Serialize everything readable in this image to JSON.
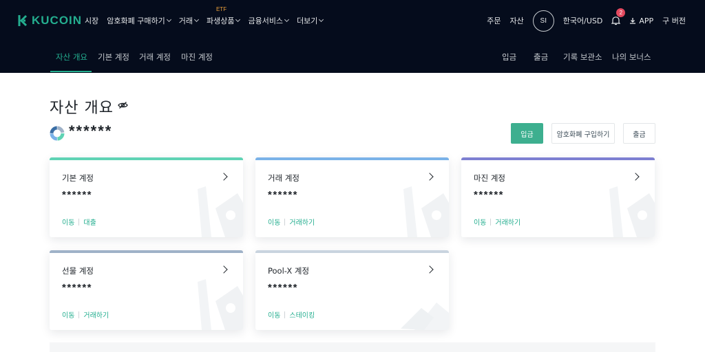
{
  "brand": {
    "name": "KUCOIN",
    "color": "#24ae8f"
  },
  "topnav": {
    "items": [
      {
        "label": "시장",
        "chevron": false
      },
      {
        "label": "암호화폐 구매하기",
        "chevron": true
      },
      {
        "label": "거래",
        "chevron": true
      },
      {
        "label": "파생상품",
        "chevron": true,
        "tag": "ETF"
      },
      {
        "label": "금융서비스",
        "chevron": true
      },
      {
        "label": "더보기",
        "chevron": true
      }
    ],
    "right": {
      "orders": "주문",
      "assets": "자산",
      "avatar": "SI",
      "language": "한국어/USD",
      "notifications": "2",
      "app": "APP",
      "old_version": "구 버전"
    }
  },
  "subnav": {
    "tabs": [
      "자산 개요",
      "기본 계정",
      "거래 계정",
      "마진 계정"
    ],
    "active": "자산 개요",
    "right": [
      "입금",
      "출금",
      "기록 보관소",
      "나의 보너스"
    ]
  },
  "main": {
    "title": "자산 개요",
    "balance": "******",
    "buttons": {
      "deposit": "입금",
      "buy": "암호화폐 구입하기",
      "withdraw": "출금"
    }
  },
  "cards": [
    {
      "title": "기본 계정",
      "value": "******",
      "links": [
        "이동",
        "대출"
      ],
      "bar_color": "#5fd3b4"
    },
    {
      "title": "거래 계정",
      "value": "******",
      "links": [
        "이동",
        "거래하기"
      ],
      "bar_color": "#7ab2e8"
    },
    {
      "title": "마진 계정",
      "value": "******",
      "links": [
        "이동",
        "거래하기"
      ],
      "bar_color": "#7d7fd1"
    },
    {
      "title": "선물 계정",
      "value": "******",
      "links": [
        "이동",
        "거래하기"
      ],
      "bar_color": "#9fb2c8"
    },
    {
      "title": "Pool-X 계정",
      "value": "******",
      "links": [
        "이동",
        "스테이킹"
      ],
      "bar_color": "#c9d4df"
    }
  ]
}
